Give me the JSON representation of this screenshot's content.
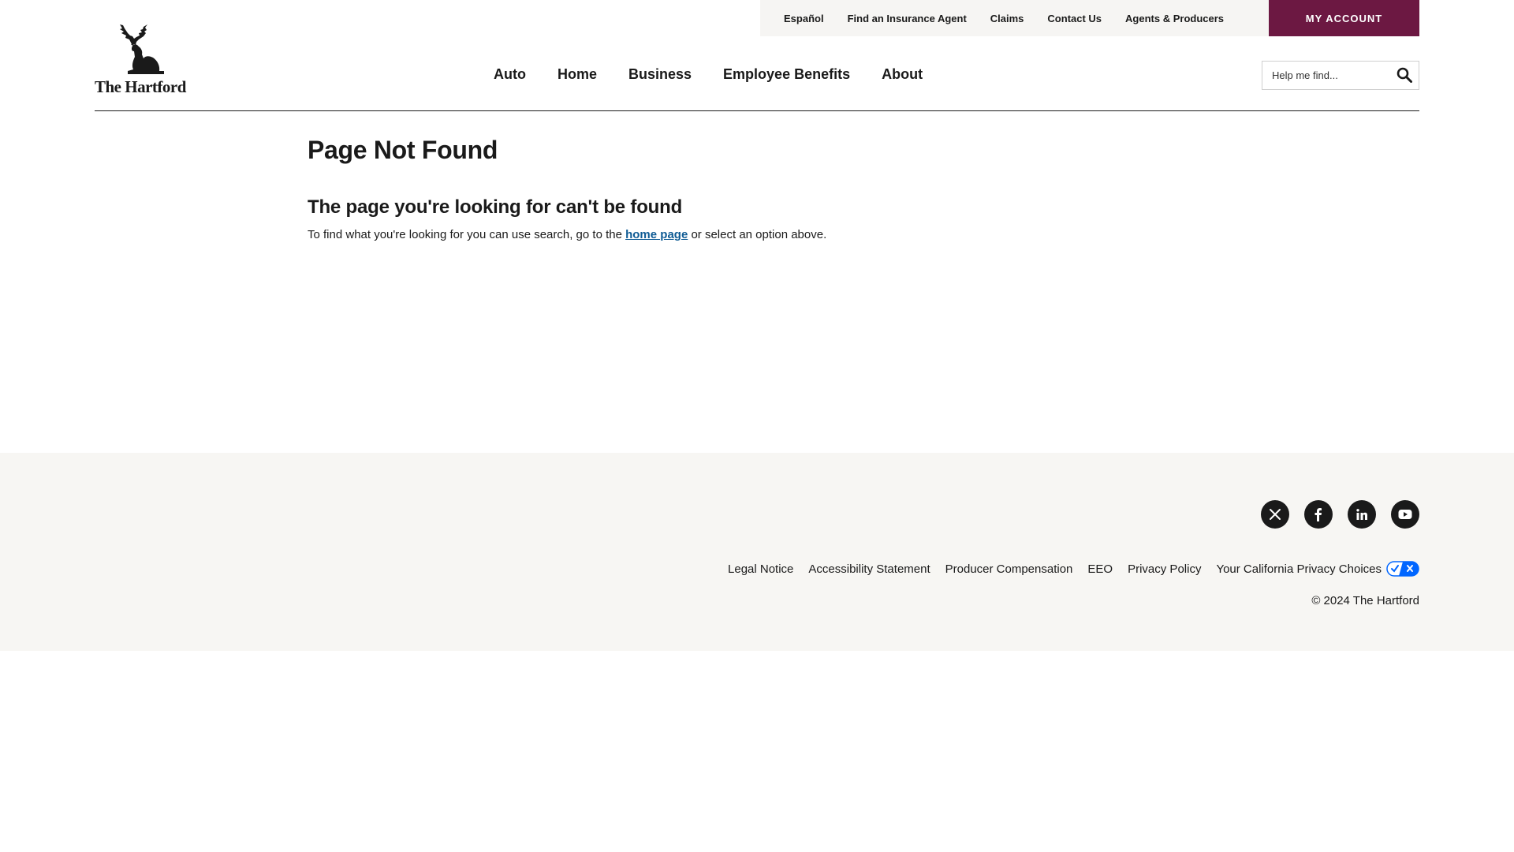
{
  "brand": {
    "name": "The Hartford",
    "accent_color": "#6c1842",
    "link_color": "#0f5b94"
  },
  "utility_nav": {
    "items": [
      {
        "label": "Español"
      },
      {
        "label": "Find an Insurance Agent"
      },
      {
        "label": "Claims"
      },
      {
        "label": "Contact Us"
      },
      {
        "label": "Agents & Producers"
      }
    ],
    "my_account_label": "MY ACCOUNT"
  },
  "main_nav": {
    "items": [
      {
        "label": "Auto"
      },
      {
        "label": "Home"
      },
      {
        "label": "Business"
      },
      {
        "label": "Employee Benefits"
      },
      {
        "label": "About"
      }
    ]
  },
  "search": {
    "placeholder": "Help me find...",
    "value": "",
    "icon": "search-icon"
  },
  "main": {
    "title": "Page Not Found",
    "subheading": "The page you're looking for can't be found",
    "body_before_link": "To find what you're looking for you can use search, go to the ",
    "link_text": "home page",
    "body_after_link": " or select an option above."
  },
  "footer": {
    "social": [
      {
        "icon": "x-icon"
      },
      {
        "icon": "facebook-icon"
      },
      {
        "icon": "linkedin-icon"
      },
      {
        "icon": "youtube-icon"
      }
    ],
    "legal_links": [
      {
        "label": "Legal Notice"
      },
      {
        "label": "Accessibility Statement"
      },
      {
        "label": "Producer Compensation"
      },
      {
        "label": "EEO"
      },
      {
        "label": "Privacy Policy"
      },
      {
        "label": "Your California Privacy Choices"
      }
    ],
    "copyright": "© 2024 The Hartford"
  }
}
